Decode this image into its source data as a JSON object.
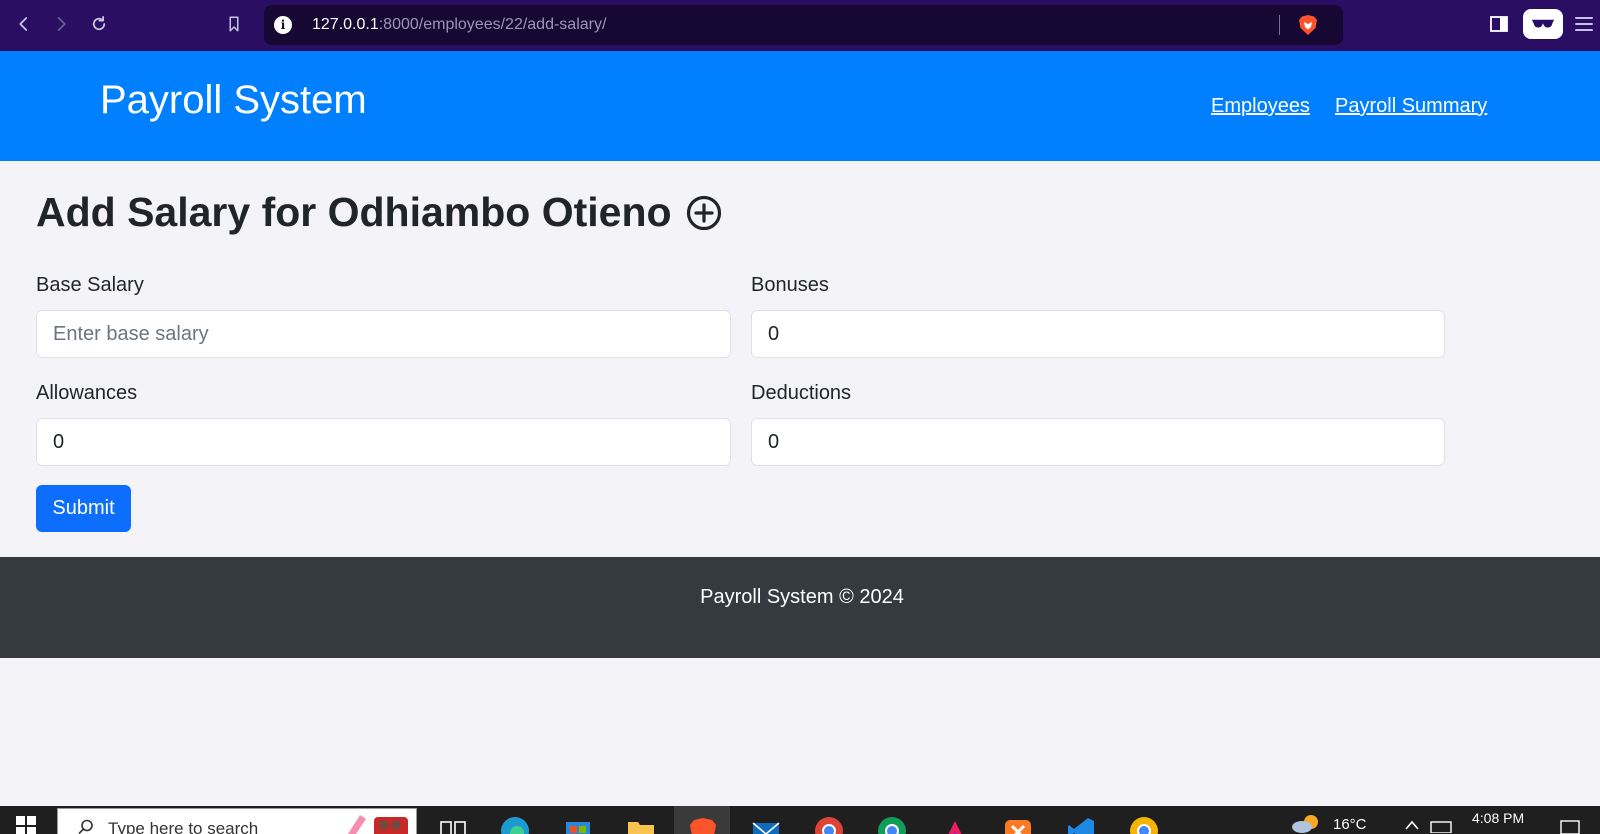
{
  "browser": {
    "url_host": "127.0.0.1",
    "url_rest": ":8000/employees/22/add-salary/"
  },
  "header": {
    "title": "Payroll System",
    "nav": [
      {
        "label": "Employees"
      },
      {
        "label": "Payroll Summary"
      }
    ]
  },
  "main": {
    "title": "Add Salary for Odhiambo Otieno",
    "title_icon": "plus-circle-icon",
    "fields": {
      "base_salary": {
        "label": "Base Salary",
        "placeholder": "Enter base salary",
        "value": ""
      },
      "bonuses": {
        "label": "Bonuses",
        "value": "0"
      },
      "allowances": {
        "label": "Allowances",
        "value": "0"
      },
      "deductions": {
        "label": "Deductions",
        "value": "0"
      }
    },
    "submit_label": "Submit"
  },
  "footer": {
    "text": "Payroll System © 2024"
  },
  "taskbar": {
    "search_placeholder": "Type here to search",
    "temperature": "16°C",
    "time": "4:08 PM"
  },
  "colors": {
    "header_bg": "#0080ff",
    "primary_button": "#0d6efd",
    "footer_bg": "#343a40",
    "browser_chrome": "#2a0e63"
  }
}
